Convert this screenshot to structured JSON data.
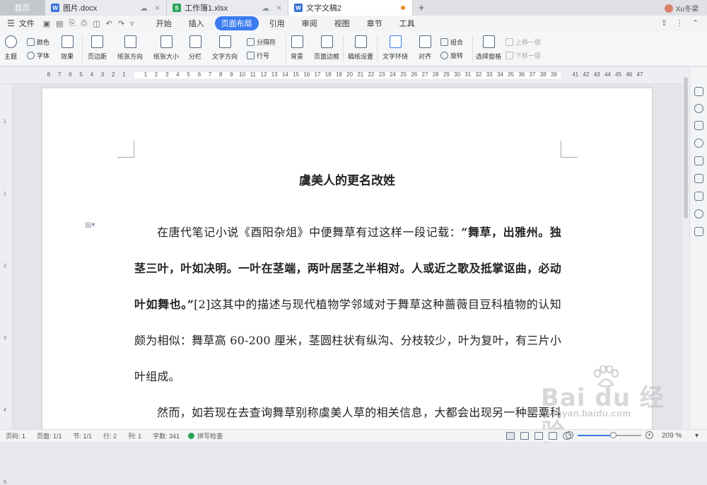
{
  "tabs": {
    "home": "首页",
    "doc1": "图片.docx",
    "doc2": "工作簿1.xlsx",
    "doc3": "文字文稿2",
    "doc1_icon": "W",
    "doc2_icon": "S",
    "doc3_icon": "W",
    "new_tab": "+",
    "user": "Xu冬梁"
  },
  "menubar": {
    "file": "文件",
    "items": [
      "开始",
      "插入",
      "页面布局",
      "引用",
      "审阅",
      "视图",
      "章节",
      "工具"
    ],
    "selected": "页面布局"
  },
  "ribbon": {
    "theme": "主题",
    "color": "颜色",
    "font": "字体",
    "effect": "效果",
    "margin": "页边距",
    "orientation": "纸张方向",
    "size": "纸张大小",
    "columns": "分栏",
    "text_direction": "文字方向",
    "separator": "分隔符",
    "line_number": "行号",
    "background": "背景",
    "page_border": "页面边框",
    "paper_setup": "稿纸设置",
    "text_wrap": "文字环绕",
    "align": "对齐",
    "group": "组合",
    "rotate": "旋转",
    "select_pane": "选择窗格",
    "bring_forward": "上移一层",
    "send_backward": "下移一层"
  },
  "ruler": {
    "ticks": [
      "8",
      "7",
      "6",
      "5",
      "4",
      "3",
      "2",
      "1",
      "",
      "1",
      "2",
      "3",
      "4",
      "5",
      "6",
      "7",
      "8",
      "9",
      "10",
      "11",
      "12",
      "13",
      "14",
      "15",
      "16",
      "17",
      "18",
      "19",
      "20",
      "21",
      "22",
      "23",
      "24",
      "25",
      "26",
      "27",
      "28",
      "29",
      "30",
      "31",
      "32",
      "33",
      "34",
      "35",
      "36",
      "37",
      "38",
      "39",
      "",
      "41",
      "42",
      "43",
      "44",
      "45",
      "46",
      "47"
    ],
    "vticks": [
      "1",
      "",
      "1",
      "",
      "2",
      "",
      "3",
      "",
      "4",
      "",
      "5"
    ]
  },
  "document": {
    "title": "虞美人的更名改姓",
    "p1_a": "在唐代笔记小说《酉阳杂俎》中便舞草有过这样一段记载：",
    "p1_bold": "“舞草，出雅州。独茎三叶，叶如决明。一叶在茎端，两叶居茎之半相对。人或近之歌及抵掌讴曲，必动叶如舞也。”",
    "p1_b": "[2]这其中的描述与现代植物学邻域对于舞草这种蔷薇目豆科植物的认知颇为相似：舞草高 60-200 厘米，茎圆柱状有纵沟、分枝较少，叶为复叶，有三片小叶组成。",
    "p2": "然而，如若现在去查询舞草别称虞美人草的相关信息，大都会出现另一种罂粟科罂粟属草本植物的介绍。而要说清道明这种巨大转变的源头，还需追溯到明代。"
  },
  "statusbar": {
    "page_code": "页码: 1",
    "pages": "页面: 1/1",
    "section": "节: 1/1",
    "row": "行: 2",
    "col": "列: 1",
    "words": "字数: 341",
    "spell": "拼写检查",
    "zoom": "209 %",
    "zoom_fraction": 0.55
  },
  "watermark": {
    "logo": "Bai du 经验",
    "url": "jingyan.baidu.com"
  },
  "colors": {
    "accent": "#3a7bf0",
    "doc_dot": "#f08a24",
    "word": "#3b73d8",
    "sheet": "#2aa55b"
  }
}
